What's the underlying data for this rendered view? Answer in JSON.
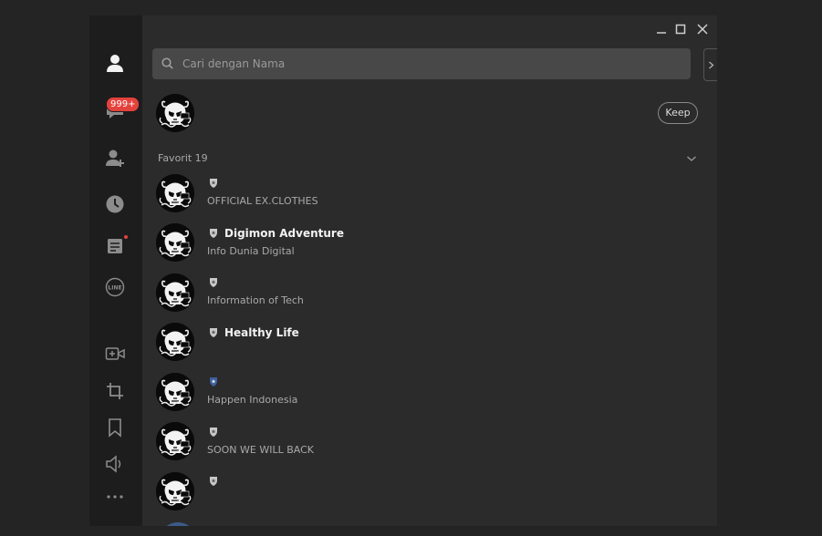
{
  "icons": {
    "profile": "person-icon",
    "chats": "chat-bubble-icon",
    "add_friend": "add-friend-icon",
    "recent": "clock-icon",
    "notes": "note-icon",
    "line": "line-logo-icon",
    "video": "video-call-icon",
    "crop": "crop-icon",
    "bookmark": "bookmark-icon",
    "volume": "speaker-icon",
    "more": "more-icon"
  },
  "chats_badge": "999+",
  "line_logo_text": "LINE",
  "search": {
    "placeholder": "Cari dengan Nama"
  },
  "keep_label": "Keep",
  "section": {
    "label": "Favorit 19"
  },
  "friends": [
    {
      "name": "",
      "status": "OFFICIAL EX.CLOTHES",
      "badge": "grey"
    },
    {
      "name": "Digimon Adventure",
      "status": "Info Dunia Digital",
      "badge": "grey"
    },
    {
      "name": "",
      "status": "Information of Tech",
      "badge": "grey"
    },
    {
      "name": "Healthy Life",
      "status": "",
      "badge": "grey"
    },
    {
      "name": "",
      "status": "Happen Indonesia",
      "badge": "blue"
    },
    {
      "name": "",
      "status": "SOON WE WILL BACK",
      "badge": "grey"
    },
    {
      "name": "",
      "status": "",
      "badge": "grey"
    }
  ],
  "colors": {
    "badge_red": "#e4423d",
    "shield_grey": "#c9c9c9",
    "shield_blue": "#5a7fbf"
  }
}
